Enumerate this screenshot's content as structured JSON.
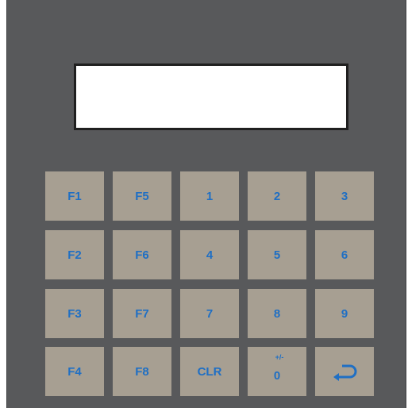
{
  "keypad": {
    "display_text": "",
    "keys": [
      {
        "name": "key-f1",
        "label": "F1"
      },
      {
        "name": "key-f5",
        "label": "F5"
      },
      {
        "name": "key-1",
        "label": "1"
      },
      {
        "name": "key-2",
        "label": "2"
      },
      {
        "name": "key-3",
        "label": "3"
      },
      {
        "name": "key-f2",
        "label": "F2"
      },
      {
        "name": "key-f6",
        "label": "F6"
      },
      {
        "name": "key-4",
        "label": "4"
      },
      {
        "name": "key-5",
        "label": "5"
      },
      {
        "name": "key-6",
        "label": "6"
      },
      {
        "name": "key-f3",
        "label": "F3"
      },
      {
        "name": "key-f7",
        "label": "F7"
      },
      {
        "name": "key-7",
        "label": "7"
      },
      {
        "name": "key-8",
        "label": "8"
      },
      {
        "name": "key-9",
        "label": "9"
      },
      {
        "name": "key-f4",
        "label": "F4"
      },
      {
        "name": "key-f8",
        "label": "F8"
      },
      {
        "name": "key-clr",
        "label": "CLR"
      },
      {
        "name": "key-0",
        "label": "0",
        "secondary": "+/-"
      },
      {
        "name": "key-enter",
        "label": "",
        "icon": "enter-return-icon"
      }
    ]
  },
  "colors": {
    "panel": "#58595b",
    "key": "#a79f92",
    "key_text": "#1f6fc4",
    "display": "#ffffff"
  }
}
